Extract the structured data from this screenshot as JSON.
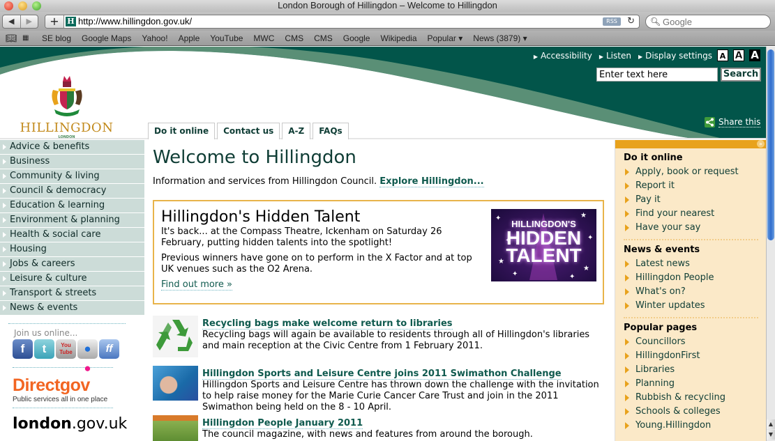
{
  "browser": {
    "window_title": "London Borough of Hillingdon – Welcome to Hillingdon",
    "url": "http://www.hillingdon.gov.uk/",
    "rss_label": "RSS",
    "search_placeholder": "Google",
    "bookmarks": [
      "SE blog",
      "Google Maps",
      "Yahoo!",
      "Apple",
      "YouTube",
      "MWC",
      "CMS",
      "CMS",
      "Google",
      "Wikipedia",
      "Popular ▾",
      "News (3879) ▾"
    ]
  },
  "header": {
    "logo_name": "HILLINGDON",
    "logo_sub": "LONDON",
    "top_links": [
      "Accessibility",
      "Listen",
      "Display settings"
    ],
    "text_size_buttons": [
      "A",
      "A",
      "A"
    ],
    "search_value": "Enter text here",
    "search_button": "Search",
    "share_label": "Share this",
    "tabs": [
      "Do it online",
      "Contact us",
      "A-Z",
      "FAQs"
    ]
  },
  "left_nav": {
    "items": [
      "Advice & benefits",
      "Business",
      "Community & living",
      "Council & democracy",
      "Education & learning",
      "Environment & planning",
      "Health & social care",
      "Housing",
      "Jobs & careers",
      "Leisure & culture",
      "Transport & streets",
      "News & events"
    ],
    "join_label": "Join us online...",
    "social": [
      {
        "name": "facebook",
        "glyph": "f"
      },
      {
        "name": "twitter",
        "glyph": "t"
      },
      {
        "name": "youtube",
        "glyph": "You Tube"
      },
      {
        "name": "flickr",
        "glyph": "●●"
      },
      {
        "name": "friendfeed",
        "glyph": "ff"
      }
    ],
    "directgov_name": "Directgov",
    "directgov_tag": "Public services all in one place",
    "london_bold": "london",
    "london_rest": ".gov.uk"
  },
  "main": {
    "title": "Welcome to Hillingdon",
    "intro": "Information and services from Hillingdon Council. ",
    "intro_link": "Explore Hillingdon...",
    "feature": {
      "title": "Hillingdon's Hidden Talent",
      "p1": "It's back... at the Compass Theatre, Ickenham on Saturday 26 February, putting hidden talents into the spotlight!",
      "p2": "Previous winners have gone on to perform in the X Factor and at top UK venues such as the O2 Arena.",
      "link": "Find out more »",
      "image_lines": [
        "HILLINGDON'S",
        "HIDDEN",
        "TALENT"
      ]
    },
    "news": [
      {
        "title": "Recycling bags make welcome return to libraries",
        "desc": "Recycling bags will again be available to residents through all of Hillingdon's libraries and main reception at the Civic Centre from 1 February 2011."
      },
      {
        "title": "Hillingdon Sports and Leisure Centre joins 2011 Swimathon Challenge",
        "desc": "Hillingdon Sports and Leisure Centre has thrown down the challenge with the invitation to help raise money for the Marie Curie Cancer Care Trust and join in the 2011 Swimathon being held on the 8 - 10 April."
      },
      {
        "title": "Hillingdon People January 2011",
        "desc": "The council magazine, with news and features from around the borough."
      }
    ]
  },
  "right_col": {
    "sections": [
      {
        "heading": "Do it online",
        "items": [
          "Apply, book or request",
          "Report it",
          "Pay it",
          "Find your nearest",
          "Have your say"
        ]
      },
      {
        "heading": "News & events",
        "items": [
          "Latest news",
          "Hillingdon People",
          "What's on?",
          "Winter updates"
        ]
      },
      {
        "heading": "Popular pages",
        "items": [
          "Councillors",
          "HillingdonFirst",
          "Libraries",
          "Planning",
          "Rubbish & recycling",
          "Schools & colleges",
          "Young.Hillingdon"
        ]
      }
    ]
  },
  "colors": {
    "brand_green": "#02554a",
    "nav_bg": "#ccdcd8",
    "accent_orange": "#e8a21c",
    "right_bg": "#fbe9c8",
    "link": "#0f5a4e"
  }
}
